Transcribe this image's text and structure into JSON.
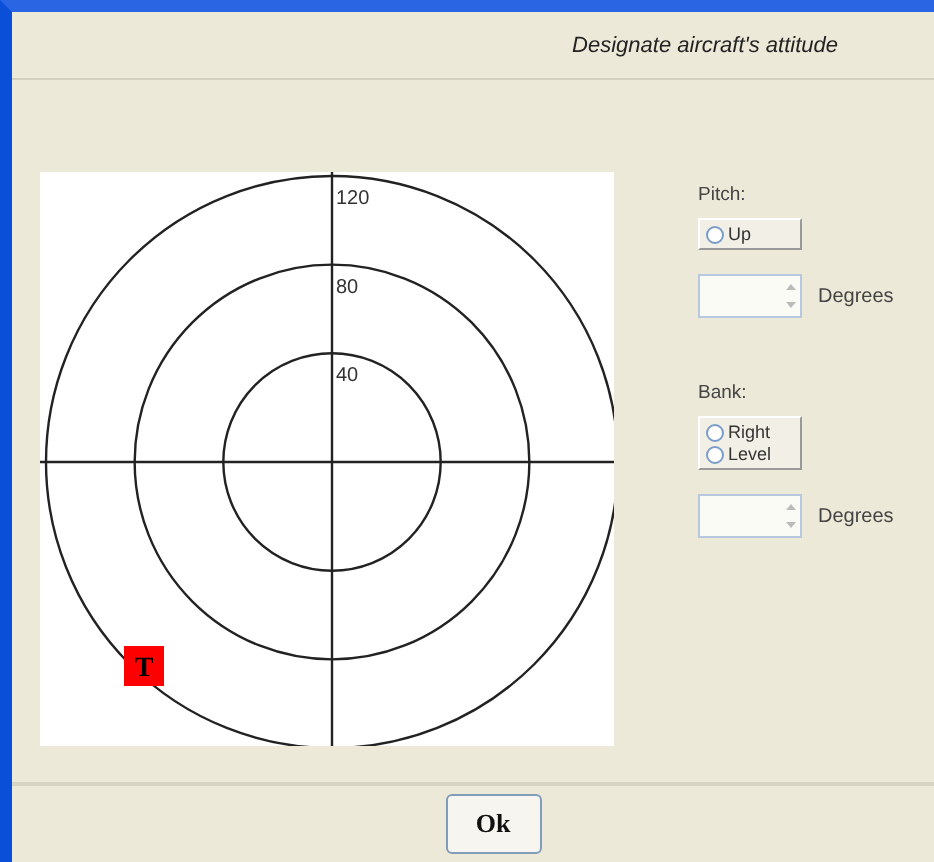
{
  "header": {
    "title": "Designate aircraft's attitude"
  },
  "plot": {
    "rings": [
      {
        "label": "120"
      },
      {
        "label": "80"
      },
      {
        "label": "40"
      }
    ],
    "marker": {
      "label": "T",
      "color": "#ff0000"
    }
  },
  "groups": [
    {
      "label": "Pitch:",
      "options": [
        {
          "label": "Up",
          "selected": false
        }
      ],
      "unit": "Degrees"
    },
    {
      "label": "Bank:",
      "options": [
        {
          "label": "Right",
          "selected": false
        },
        {
          "label": "Level",
          "selected": false
        }
      ],
      "unit": "Degrees"
    }
  ],
  "ok_button": {
    "label": "Ok"
  }
}
